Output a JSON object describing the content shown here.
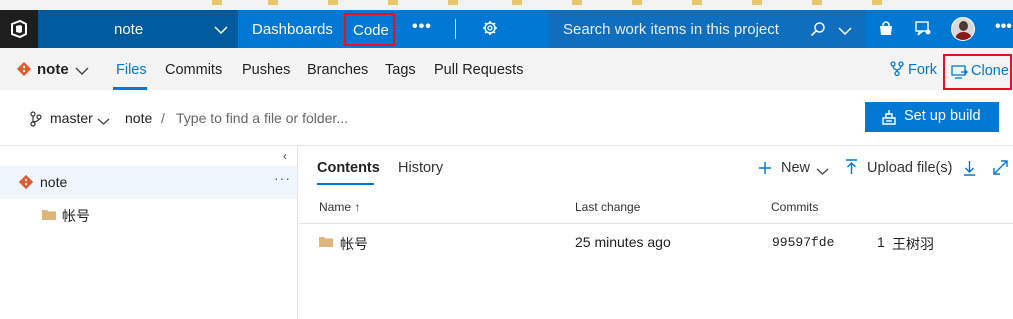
{
  "nav": {
    "project": "note",
    "dashboards": "Dashboards",
    "code": "Code",
    "more": "•••",
    "search_placeholder": "Search work items in this project",
    "more_right": "•••"
  },
  "subnav": {
    "repo": "note",
    "tabs": [
      {
        "label": "Files",
        "active": true
      },
      {
        "label": "Commits"
      },
      {
        "label": "Pushes"
      },
      {
        "label": "Branches"
      },
      {
        "label": "Tags"
      },
      {
        "label": "Pull Requests"
      }
    ],
    "fork": "Fork",
    "clone": "Clone"
  },
  "branchbar": {
    "branch": "master",
    "path_root": "note",
    "path_sep": "/",
    "path_placeholder": "Type to find a file or folder...",
    "setup_build": "Set up build"
  },
  "tree": {
    "root": "note",
    "root_more": "···",
    "child": "帐号"
  },
  "content": {
    "tabs": [
      "Contents",
      "History"
    ],
    "new_label": "New",
    "upload_label": "Upload file(s)",
    "columns": {
      "name": "Name",
      "sort_indicator": "↑",
      "last_change": "Last change",
      "commits": "Commits"
    },
    "rows": [
      {
        "name": "帐号",
        "last_change": "25 minutes ago",
        "commit_id": "99597fde",
        "commit_count": "1",
        "author": "王树羽"
      }
    ]
  },
  "colors": {
    "accent": "#0078d4",
    "nav_dark": "#005a9e",
    "highlight": "#e81123",
    "repo_icon": "#e05a2b",
    "folder": "#dcb67a"
  }
}
